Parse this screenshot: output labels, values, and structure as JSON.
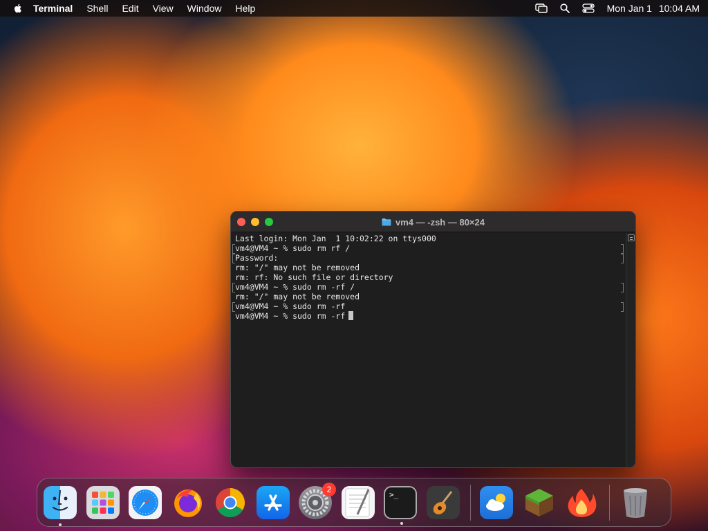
{
  "menubar": {
    "app_name": "Terminal",
    "items": [
      "Shell",
      "Edit",
      "View",
      "Window",
      "Help"
    ],
    "date": "Mon Jan 1",
    "time": "10:04 AM"
  },
  "terminal": {
    "title": "vm4 — -zsh — 80×24",
    "lines": [
      "Last login: Mon Jan  1 10:02:22 on ttys000",
      "vm4@VM4 ~ % sudo rm rf /",
      "Password:",
      "rm: \"/\" may not be removed",
      "rm: rf: No such file or directory",
      "vm4@VM4 ~ % sudo rm -rf /",
      "rm: \"/\" may not be removed",
      "vm4@VM4 ~ % sudo rm -rf",
      "vm4@VM4 ~ % sudo rm -rf"
    ]
  },
  "dock": {
    "settings_badge": "2",
    "terminal_icon_text": ">_",
    "items": [
      "finder",
      "launchpad",
      "safari",
      "firefox",
      "chrome",
      "app-store",
      "system-settings",
      "textedit",
      "terminal",
      "garageband",
      "weather",
      "minecraft",
      "flame",
      "trash"
    ]
  },
  "colors": {
    "close": "#ff5f57",
    "minimize": "#febc2e",
    "maximize": "#28c840",
    "terminal_bg": "#1e1e1e"
  }
}
